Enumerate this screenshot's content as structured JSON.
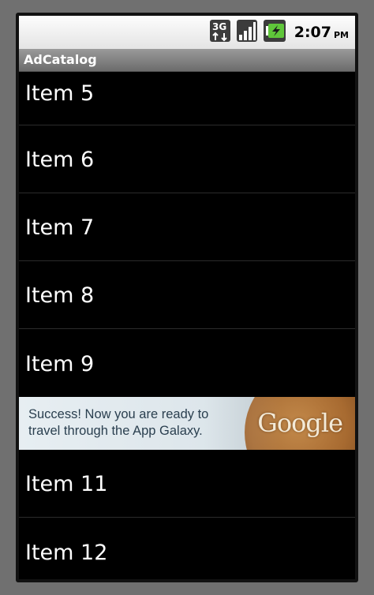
{
  "status_bar": {
    "network_icon": "3g-data-icon",
    "signal_icon": "signal-strength-icon",
    "battery_icon": "battery-charging-icon",
    "time": "2:07",
    "ampm": "PM"
  },
  "app": {
    "title": "AdCatalog"
  },
  "list": {
    "items_before_ad": [
      "Item 5",
      "Item 6",
      "Item 7",
      "Item 8",
      "Item 9"
    ],
    "items_after_ad": [
      "Item 11",
      "Item 12"
    ]
  },
  "ad": {
    "line1": "Success! Now you are ready to",
    "line2": "travel through the App Galaxy.",
    "logo_text": "Google"
  },
  "colors": {
    "status_bar_bg": "#f2f2f2",
    "title_bar_bg": "#7f7f7f",
    "list_bg": "#000000",
    "list_text": "#ffffff",
    "divider": "#2b2b2b"
  }
}
